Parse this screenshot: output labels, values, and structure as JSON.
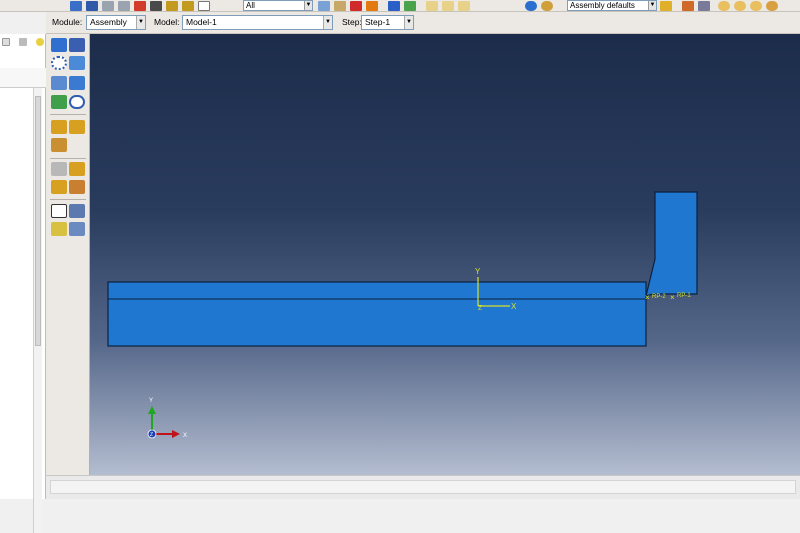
{
  "toolbar": {
    "selection_filter": "All",
    "view_defaults": "Assembly defaults"
  },
  "context": {
    "module_label": "Module:",
    "module_value": "Assembly",
    "model_label": "Model:",
    "model_value": "Model-1",
    "step_label": "Step:",
    "step_value": "Step-1"
  },
  "viewport": {
    "axis_y": "Y",
    "axis_x": "X",
    "axis_z": "Z",
    "rp2_label": "RP-2",
    "rp1_label": "RP-1",
    "triad_y": "Y",
    "triad_x": "X",
    "triad_z": "Z"
  },
  "colors": {
    "part_fill": "#1f77d0",
    "part_edge": "#0b2140",
    "axis_yellow": "#d6e02a",
    "triad_green": "#1ea81e",
    "triad_red": "#c0141a",
    "triad_blue": "#1a3fb8"
  },
  "icons": {
    "palette": [
      "create-instance-icon",
      "linear-pattern-icon",
      "radial-pattern-icon",
      "translate-instance-icon",
      "rotate-instance-icon",
      "translate-to-icon",
      "merge-cut-icon",
      "boolean-icon",
      "parallel-face-icon",
      "face-to-face-icon",
      "edge-to-edge-icon",
      "coaxial-icon",
      "contact-icon",
      "coincident-point-icon",
      "parallel-csys-icon",
      "datum-csys-icon",
      "datum-point-icon",
      "datum-axis-icon",
      "datum-plane-icon",
      "datum-tools-icon"
    ]
  }
}
